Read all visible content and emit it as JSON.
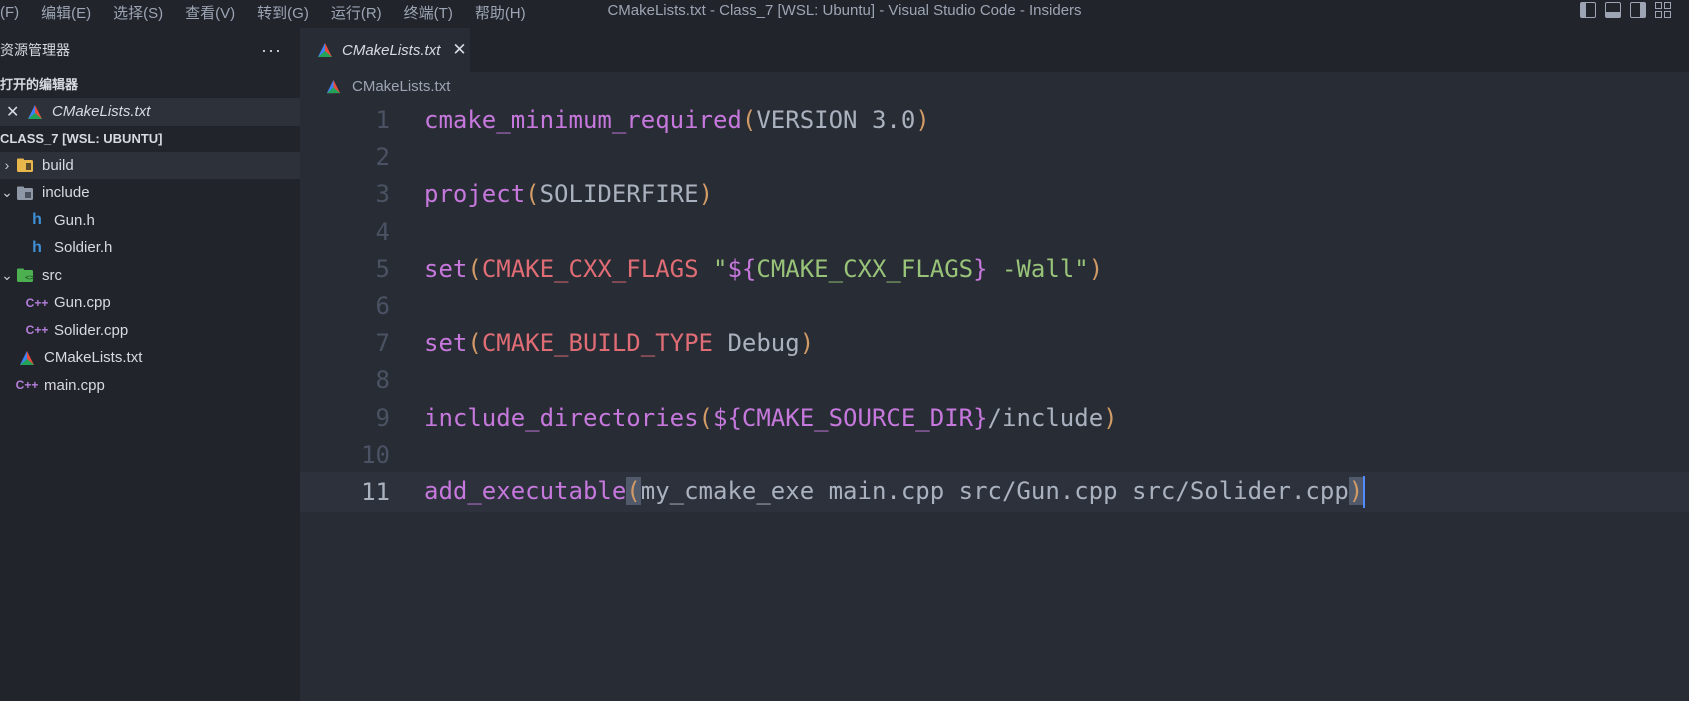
{
  "menu": [
    "(F)",
    "编辑(E)",
    "选择(S)",
    "查看(V)",
    "转到(G)",
    "运行(R)",
    "终端(T)",
    "帮助(H)"
  ],
  "window_title": "CMakeLists.txt - Class_7 [WSL: Ubuntu] - Visual Studio Code - Insiders",
  "sidebar": {
    "title": "资源管理器",
    "more": "···",
    "open_editors_label": "打开的编辑器",
    "open_editor_file": "CMakeLists.txt",
    "workspace_label": "CLASS_7 [WSL: UBUNTU]",
    "tree": [
      {
        "name": "build"
      },
      {
        "name": "include"
      },
      {
        "name": "Gun.h"
      },
      {
        "name": "Soldier.h"
      },
      {
        "name": "src"
      },
      {
        "name": "Gun.cpp"
      },
      {
        "name": "Solider.cpp"
      },
      {
        "name": "CMakeLists.txt"
      },
      {
        "name": "main.cpp"
      }
    ]
  },
  "tab": {
    "label": "CMakeLists.txt",
    "close": "✕"
  },
  "breadcrumb": "CMakeLists.txt",
  "editor": {
    "line_numbers": [
      "1",
      "2",
      "3",
      "4",
      "5",
      "6",
      "7",
      "8",
      "9",
      "10",
      "11"
    ],
    "lines": [
      [
        [
          "kw",
          "cmake_minimum_required"
        ],
        [
          "par",
          "("
        ],
        [
          "txt",
          "VERSION 3.0"
        ],
        [
          "par",
          ")"
        ]
      ],
      [],
      [
        [
          "kw",
          "project"
        ],
        [
          "par",
          "("
        ],
        [
          "txt",
          "SOLIDERFIRE"
        ],
        [
          "par",
          ")"
        ]
      ],
      [],
      [
        [
          "kw",
          "set"
        ],
        [
          "par",
          "("
        ],
        [
          "var",
          "CMAKE_CXX_FLAGS"
        ],
        [
          "txt",
          " "
        ],
        [
          "str",
          "\""
        ],
        [
          "kw",
          "${"
        ],
        [
          "str",
          "CMAKE_CXX_FLAGS"
        ],
        [
          "kw",
          "}"
        ],
        [
          "str",
          " -Wall"
        ],
        [
          "str",
          "\""
        ],
        [
          "par",
          ")"
        ]
      ],
      [],
      [
        [
          "kw",
          "set"
        ],
        [
          "par",
          "("
        ],
        [
          "var",
          "CMAKE_BUILD_TYPE"
        ],
        [
          "txt",
          " Debug"
        ],
        [
          "par",
          ")"
        ]
      ],
      [],
      [
        [
          "kw",
          "include_directories"
        ],
        [
          "par",
          "("
        ],
        [
          "kw",
          "${CMAKE_SOURCE_DIR}"
        ],
        [
          "txt",
          "/include"
        ],
        [
          "par",
          ")"
        ]
      ],
      [],
      [
        [
          "kw",
          "add_executable"
        ],
        [
          "match",
          "("
        ],
        [
          "txt",
          "my_cmake_exe main.cpp src/Gun.cpp src/Solider.cpp"
        ],
        [
          "match",
          ")"
        ]
      ]
    ]
  },
  "colors": {
    "accent": "#528bff",
    "keyword": "#c678dd",
    "paren": "#d19a66",
    "variable": "#e06c75",
    "string": "#98c379"
  }
}
